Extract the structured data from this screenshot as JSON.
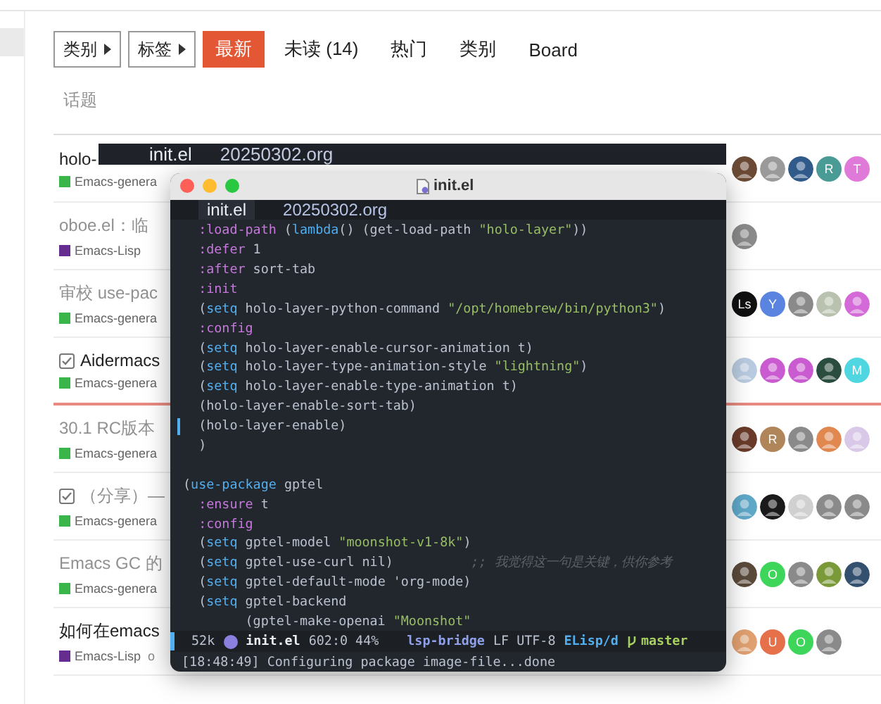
{
  "nav": {
    "dropdowns": [
      {
        "label": "类别"
      },
      {
        "label": "标签"
      }
    ],
    "tabs": [
      {
        "label": "最新",
        "selected": true
      },
      {
        "label": "未读 (14)",
        "selected": false
      },
      {
        "label": "热门",
        "selected": false
      },
      {
        "label": "类别",
        "selected": false
      },
      {
        "label": "Board",
        "selected": false
      }
    ]
  },
  "list_header": "话题",
  "topics": [
    {
      "title": "holo-",
      "read": false,
      "solved": false,
      "last_visit_divider": false,
      "category": {
        "name": "Emacs-genera",
        "color": "#3ab54a"
      },
      "avatars": [
        {
          "color": "#6b4a35"
        },
        {
          "color": "#9a9a9a"
        },
        {
          "color": "#2f5a8a"
        },
        {
          "letter": "R",
          "color": "#4a9a96"
        },
        {
          "letter": "T",
          "color": "#e07ad8"
        }
      ]
    },
    {
      "title": "oboe.el：临",
      "read": true,
      "solved": false,
      "last_visit_divider": false,
      "category": {
        "name": "Emacs-Lisp",
        "color": "#652d90"
      },
      "avatars": [
        {
          "color": "#8a8a8a"
        }
      ]
    },
    {
      "title": "审校 use-pac",
      "read": true,
      "solved": false,
      "last_visit_divider": false,
      "category": {
        "name": "Emacs-genera",
        "color": "#3ab54a"
      },
      "avatars": [
        {
          "letter": "Ls",
          "color": "#111111"
        },
        {
          "letter": "Y",
          "color": "#5b84e0"
        },
        {
          "color": "#8a8a8a"
        },
        {
          "color": "#b8c2ae"
        },
        {
          "color": "#d36ad8"
        }
      ]
    },
    {
      "title": "Aidermacs",
      "read": false,
      "solved": true,
      "last_visit_divider": true,
      "category": {
        "name": "Emacs-genera",
        "color": "#3ab54a"
      },
      "avatars": [
        {
          "color": "#b9cbe0"
        },
        {
          "color": "#c95ad0"
        },
        {
          "color": "#c95ad0"
        },
        {
          "color": "#2a4d3f"
        },
        {
          "letter": "M",
          "color": "#4fd6e0"
        }
      ]
    },
    {
      "title": "30.1 RC版本",
      "read": true,
      "solved": false,
      "last_visit_divider": false,
      "category": {
        "name": "Emacs-genera",
        "color": "#3ab54a"
      },
      "avatars": [
        {
          "color": "#6a3b2a"
        },
        {
          "letter": "R",
          "color": "#b0855a"
        },
        {
          "color": "#8a8a8a"
        },
        {
          "color": "#e08850"
        },
        {
          "color": "#d9c8e8"
        }
      ]
    },
    {
      "title": "（分享）—",
      "read": true,
      "solved": true,
      "last_visit_divider": false,
      "category": {
        "name": "Emacs-genera",
        "color": "#3ab54a"
      },
      "avatars": [
        {
          "color": "#5fa8c8"
        },
        {
          "color": "#1a1a1a"
        },
        {
          "color": "#d0d0d0"
        },
        {
          "color": "#8a8a8a"
        },
        {
          "color": "#8a8a8a"
        }
      ]
    },
    {
      "title": "Emacs GC 的",
      "read": true,
      "solved": false,
      "last_visit_divider": false,
      "category": {
        "name": "Emacs-genera",
        "color": "#3ab54a"
      },
      "avatars": [
        {
          "color": "#5a4a3a"
        },
        {
          "letter": "O",
          "color": "#3ed65a"
        },
        {
          "color": "#8a8a8a"
        },
        {
          "color": "#7a9a3a"
        },
        {
          "color": "#33506e"
        }
      ]
    },
    {
      "title": "如何在emacs",
      "read": false,
      "solved": false,
      "last_visit_divider": false,
      "category": {
        "name": "Emacs-Lisp",
        "color": "#652d90"
      },
      "tag": "o",
      "avatars": [
        {
          "color": "#e0a070"
        },
        {
          "letter": "U",
          "color": "#e6704a"
        },
        {
          "letter": "O",
          "color": "#3ed65a"
        },
        {
          "color": "#8a8a8a"
        }
      ]
    }
  ],
  "background_tabbar": {
    "tabs": [
      {
        "label": "init.el",
        "selected": true
      },
      {
        "label": "20250302.org",
        "selected": false
      }
    ]
  },
  "editor": {
    "title": "init.el",
    "tabs": [
      {
        "label": "init.el",
        "selected": true
      },
      {
        "label": "20250302.org",
        "selected": false
      }
    ],
    "lines": [
      {
        "fringe": false,
        "segments": [
          {
            "kind": "keyword",
            "text": "  :load-path"
          },
          {
            "kind": "plain",
            "text": " ("
          },
          {
            "kind": "builtin",
            "text": "lambda"
          },
          {
            "kind": "plain",
            "text": "() (get-load-path "
          },
          {
            "kind": "string",
            "text": "\"holo-layer\""
          },
          {
            "kind": "plain",
            "text": "))"
          }
        ]
      },
      {
        "fringe": false,
        "segments": [
          {
            "kind": "keyword",
            "text": "  :defer"
          },
          {
            "kind": "plain",
            "text": " 1"
          }
        ]
      },
      {
        "fringe": false,
        "segments": [
          {
            "kind": "keyword",
            "text": "  :after"
          },
          {
            "kind": "plain",
            "text": " sort-tab"
          }
        ]
      },
      {
        "fringe": false,
        "segments": [
          {
            "kind": "keyword",
            "text": "  :init"
          }
        ]
      },
      {
        "fringe": false,
        "segments": [
          {
            "kind": "plain",
            "text": "  ("
          },
          {
            "kind": "builtin",
            "text": "setq"
          },
          {
            "kind": "plain",
            "text": " holo-layer-python-command "
          },
          {
            "kind": "string",
            "text": "\"/opt/homebrew/bin/python3\""
          },
          {
            "kind": "plain",
            "text": ")"
          }
        ]
      },
      {
        "fringe": false,
        "segments": [
          {
            "kind": "keyword",
            "text": "  :config"
          }
        ]
      },
      {
        "fringe": false,
        "segments": [
          {
            "kind": "plain",
            "text": "  ("
          },
          {
            "kind": "builtin",
            "text": "setq"
          },
          {
            "kind": "plain",
            "text": " holo-layer-enable-cursor-animation t)"
          }
        ]
      },
      {
        "fringe": false,
        "segments": [
          {
            "kind": "plain",
            "text": "  ("
          },
          {
            "kind": "builtin",
            "text": "setq"
          },
          {
            "kind": "plain",
            "text": " holo-layer-type-animation-style "
          },
          {
            "kind": "string",
            "text": "\"lightning\""
          },
          {
            "kind": "plain",
            "text": ")"
          }
        ]
      },
      {
        "fringe": false,
        "segments": [
          {
            "kind": "plain",
            "text": "  ("
          },
          {
            "kind": "builtin",
            "text": "setq"
          },
          {
            "kind": "plain",
            "text": " holo-layer-enable-type-animation t)"
          }
        ]
      },
      {
        "fringe": false,
        "segments": [
          {
            "kind": "plain",
            "text": "  (holo-layer-enable-sort-tab)"
          }
        ]
      },
      {
        "fringe": true,
        "segments": [
          {
            "kind": "plain",
            "text": "  (holo-layer-enable)"
          }
        ]
      },
      {
        "fringe": false,
        "segments": [
          {
            "kind": "plain",
            "text": "  )"
          }
        ]
      },
      {
        "fringe": false
      },
      {
        "fringe": false,
        "segments": [
          {
            "kind": "plain",
            "text": "("
          },
          {
            "kind": "builtin",
            "text": "use-package"
          },
          {
            "kind": "plain",
            "text": " gptel"
          }
        ]
      },
      {
        "fringe": false,
        "segments": [
          {
            "kind": "keyword",
            "text": "  :ensure"
          },
          {
            "kind": "plain",
            "text": " t"
          }
        ]
      },
      {
        "fringe": false,
        "segments": [
          {
            "kind": "keyword",
            "text": "  :config"
          }
        ]
      },
      {
        "fringe": false,
        "segments": [
          {
            "kind": "plain",
            "text": "  ("
          },
          {
            "kind": "builtin",
            "text": "setq"
          },
          {
            "kind": "plain",
            "text": " gptel-model "
          },
          {
            "kind": "string",
            "text": "\"moonshot-v1-8k\""
          },
          {
            "kind": "plain",
            "text": ")"
          }
        ]
      },
      {
        "fringe": false,
        "segments": [
          {
            "kind": "plain",
            "text": "  ("
          },
          {
            "kind": "builtin",
            "text": "setq"
          },
          {
            "kind": "plain",
            "text": " gptel-use-curl nil)          "
          },
          {
            "kind": "comment",
            "text": ";; 我觉得这一句是关键，供你参考"
          }
        ]
      },
      {
        "fringe": false,
        "segments": [
          {
            "kind": "plain",
            "text": "  ("
          },
          {
            "kind": "builtin",
            "text": "setq"
          },
          {
            "kind": "plain",
            "text": " gptel-default-mode 'org-mode)"
          }
        ]
      },
      {
        "fringe": false,
        "segments": [
          {
            "kind": "plain",
            "text": "  ("
          },
          {
            "kind": "builtin",
            "text": "setq"
          },
          {
            "kind": "plain",
            "text": " gptel-backend"
          }
        ]
      },
      {
        "fringe": false,
        "segments": [
          {
            "kind": "plain",
            "text": "        (gptel-make-openai "
          },
          {
            "kind": "string",
            "text": "\"Moonshot\""
          }
        ]
      }
    ],
    "mode_line": [
      {
        "kind": "plain",
        "text": "52k"
      },
      {
        "kind": "file",
        "text": "init.el"
      },
      {
        "kind": "plain",
        "text": "602:0 44%"
      },
      {
        "kind": "lsp",
        "text": "lsp-bridge"
      },
      {
        "kind": "plain",
        "text": "LF UTF-8"
      },
      {
        "kind": "mode",
        "text": "ELisp/d"
      },
      {
        "kind": "branch",
        "text": "master"
      }
    ],
    "echo": "[18:48:49] Configuring package image-file...done"
  }
}
